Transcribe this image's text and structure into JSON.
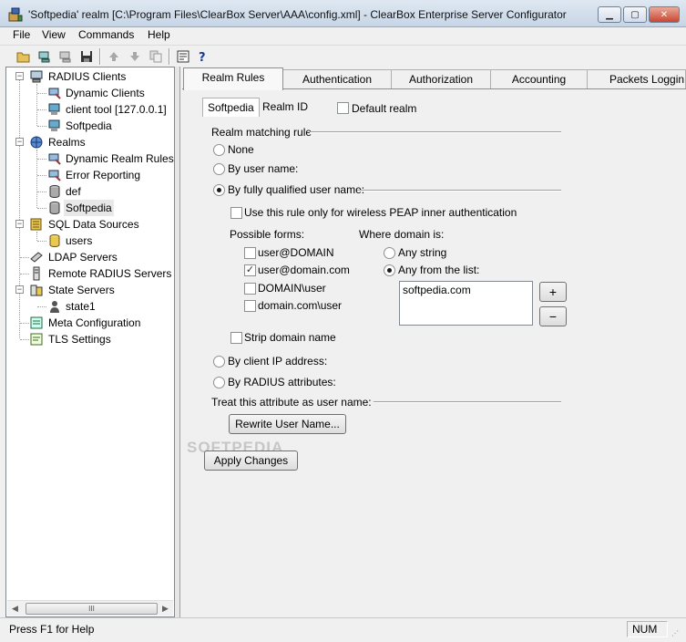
{
  "window": {
    "title": "'Softpedia' realm [C:\\Program Files\\ClearBox Server\\AAA\\config.xml] - ClearBox Enterprise Server Configurator"
  },
  "menu": [
    "File",
    "View",
    "Commands",
    "Help"
  ],
  "toolbar": {
    "icons": [
      "open-folder",
      "connect",
      "disconnect",
      "save",
      "move-up",
      "move-down",
      "copy",
      "properties",
      "help"
    ]
  },
  "tree": {
    "radius_clients": "RADIUS Clients",
    "dynamic_clients": "Dynamic Clients",
    "client_tool": "client tool [127.0.0.1]",
    "softpedia_client": "Softpedia",
    "realms": "Realms",
    "dynamic_realm_rules": "Dynamic Realm Rules",
    "error_reporting": "Error Reporting",
    "def": "def",
    "softpedia_realm": "Softpedia",
    "sql_data_sources": "SQL Data Sources",
    "users": "users",
    "ldap_servers": "LDAP Servers",
    "remote_radius_servers": "Remote RADIUS Servers",
    "state_servers": "State Servers",
    "state1": "state1",
    "meta_configuration": "Meta Configuration",
    "tls_settings": "TLS Settings",
    "scroll_thumb": "III"
  },
  "tabs": {
    "realm_rules": "Realm Rules",
    "authentication": "Authentication",
    "authorization": "Authorization",
    "accounting": "Accounting",
    "packets_logging": "Packets Loggin"
  },
  "subtabs": {
    "softpedia": "Softpedia",
    "realm_id": "Realm ID"
  },
  "form": {
    "default_realm": "Default realm",
    "realm_matching_rule": "Realm matching rule",
    "none": "None",
    "by_user_name": "By user name:",
    "by_fqun": "By fully qualified user name:",
    "use_peap_only": "Use this rule only for wireless PEAP inner authentication",
    "possible_forms": "Possible forms:",
    "form_user_at_domain": "user@DOMAIN",
    "form_user_at_domain_com": "user@domain.com",
    "form_domain_backslash_user": "DOMAIN\\user",
    "form_domain_com_backslash_user": "domain.com\\user",
    "where_domain_is": "Where domain is:",
    "any_string": "Any string",
    "any_from_list": "Any from the list:",
    "domain_list": [
      "softpedia.com"
    ],
    "add_button": "+",
    "remove_button": "−",
    "strip_domain_name": "Strip domain name",
    "by_client_ip": "By client IP address:",
    "by_radius_attributes": "By RADIUS attributes:",
    "treat_attribute": "Treat this attribute as user name:",
    "rewrite_user_name": "Rewrite User Name...",
    "apply_changes": "Apply Changes"
  },
  "watermark": "SOFTPEDIA",
  "status": {
    "help_text": "Press F1 for Help",
    "num": "NUM"
  }
}
